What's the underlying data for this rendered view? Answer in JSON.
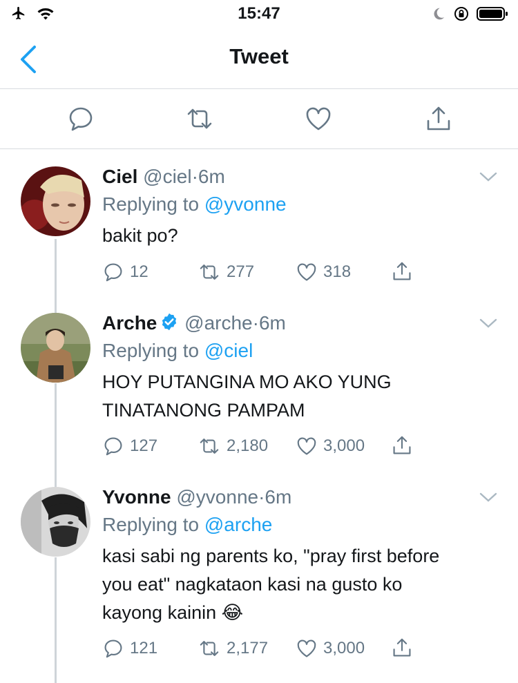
{
  "status_bar": {
    "time": "15:47"
  },
  "nav": {
    "title": "Tweet"
  },
  "colors": {
    "link": "#1da1f2",
    "muted": "#657786",
    "divider": "#d7dbdf",
    "verified": "#1da1f2"
  },
  "tweets": [
    {
      "name": "Ciel",
      "handle": "@ciel",
      "sep": "·",
      "time": "6m",
      "reply_prefix": "Replying to",
      "reply_to": "@yvonne",
      "text": "bakit po?",
      "replies": "12",
      "retweets": "277",
      "likes": "318",
      "verified": false
    },
    {
      "name": "Arche",
      "handle": "@arche",
      "sep": "·",
      "time": "6m",
      "reply_prefix": "Replying to",
      "reply_to": "@ciel",
      "text_line1": "HOY PUTANGINA MO AKO YUNG",
      "text_line2": "TINATANONG PAMPAM",
      "replies": "127",
      "retweets": "2,180",
      "likes": "3,000",
      "verified": true
    },
    {
      "name": "Yvonne",
      "handle": "@yvonne",
      "sep": "·",
      "time": "6m",
      "reply_prefix": "Replying to",
      "reply_to": "@arche",
      "text_line1": "kasi sabi ng parents ko, \"pray first before",
      "text_line2": "you eat\" nagkataon kasi na gusto ko",
      "text_line3": "kayong kainin",
      "emoji": "😂",
      "replies": "121",
      "retweets": "2,177",
      "likes": "3,000",
      "verified": false
    }
  ]
}
